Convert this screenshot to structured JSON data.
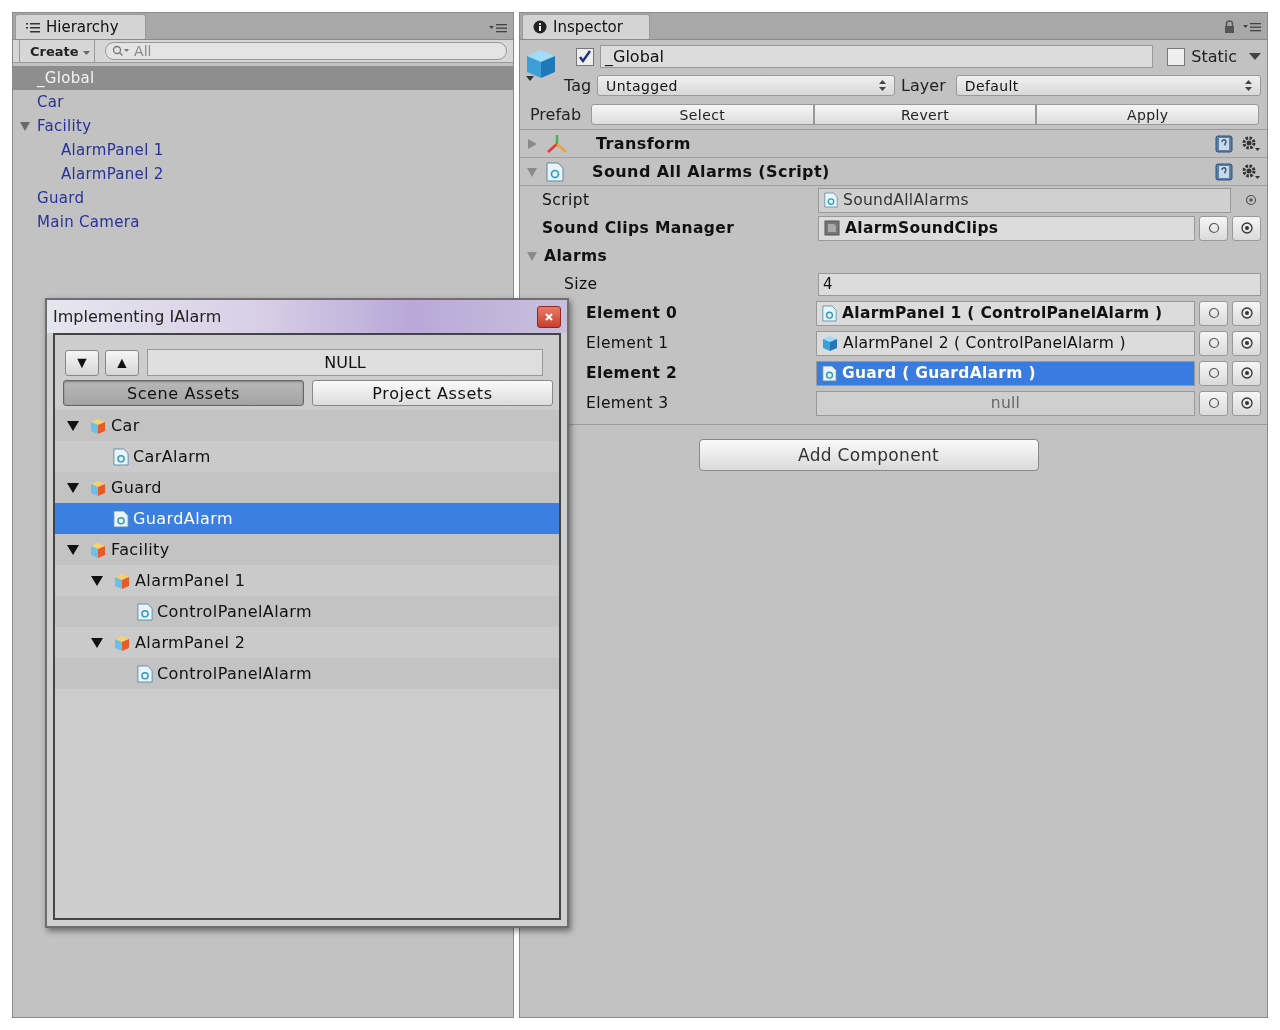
{
  "hierarchy": {
    "tab_label": "Hierarchy",
    "create_label": "Create",
    "search_placeholder": "All",
    "items": [
      {
        "label": "_Global",
        "selected": true
      },
      {
        "label": "Car",
        "selected": false
      },
      {
        "label": "Facility",
        "selected": false,
        "expanded": true,
        "children": [
          {
            "label": "AlarmPanel 1",
            "selected": false
          },
          {
            "label": "AlarmPanel 2",
            "selected": false
          }
        ]
      },
      {
        "label": "Guard",
        "selected": false
      },
      {
        "label": "Main Camera",
        "selected": false
      }
    ]
  },
  "inspector": {
    "tab_label": "Inspector",
    "object_active": true,
    "object_name": "_Global",
    "static": false,
    "static_label": "Static",
    "tag_label": "Tag",
    "tag_value": "Untagged",
    "layer_label": "Layer",
    "layer_value": "Default",
    "prefab_label": "Prefab",
    "prefab_buttons": [
      "Select",
      "Revert",
      "Apply"
    ],
    "components": [
      {
        "kind": "transform",
        "name": "Transform",
        "expanded": false
      },
      {
        "kind": "script",
        "name": "Sound All Alarms (Script)",
        "expanded": true,
        "fields": [
          {
            "kind": "script_ref",
            "label": "Script",
            "value": "SoundAllAlarms",
            "bold": false
          },
          {
            "kind": "object",
            "label": "Sound Clips Manager",
            "value": "AlarmSoundClips",
            "bold": true
          },
          {
            "kind": "array",
            "label": "Alarms",
            "expanded": true,
            "size_label": "Size",
            "size": "4",
            "elements": [
              {
                "kind": "script",
                "label": "Element 0",
                "value": "AlarmPanel 1 ( ControlPanelAlarm )",
                "bold": true,
                "selected": false
              },
              {
                "kind": "gameobject",
                "label": "Element 1",
                "value": "AlarmPanel 2 ( ControlPanelAlarm )",
                "bold": false,
                "selected": false
              },
              {
                "kind": "script",
                "label": "Element 2",
                "value": "Guard ( GuardAlarm )",
                "bold": true,
                "selected": true
              },
              {
                "kind": "none",
                "label": "Element 3",
                "value": "null",
                "bold": false,
                "selected": false
              }
            ]
          }
        ]
      }
    ],
    "add_component": "Add Component"
  },
  "dialog": {
    "title": "Implementing IAlarm",
    "null_label": "NULL",
    "down_label": "▼",
    "up_label": "▲",
    "tabs": [
      {
        "label": "Scene Assets",
        "selected": true
      },
      {
        "label": "Project Assets",
        "selected": false
      }
    ],
    "tree": [
      {
        "kind": "gameobject",
        "label": "Car",
        "expanded": true,
        "selected": false,
        "children": [
          {
            "kind": "script",
            "label": "CarAlarm",
            "selected": false
          }
        ]
      },
      {
        "kind": "gameobject",
        "label": "Guard",
        "expanded": true,
        "selected": false,
        "children": [
          {
            "kind": "script",
            "label": "GuardAlarm",
            "selected": true
          }
        ]
      },
      {
        "kind": "gameobject",
        "label": "Facility",
        "expanded": true,
        "selected": false,
        "children": [
          {
            "kind": "gameobject",
            "label": "AlarmPanel 1",
            "expanded": true,
            "selected": false,
            "children": [
              {
                "kind": "script",
                "label": "ControlPanelAlarm",
                "selected": false
              }
            ]
          },
          {
            "kind": "gameobject",
            "label": "AlarmPanel 2",
            "expanded": true,
            "selected": false,
            "children": [
              {
                "kind": "script",
                "label": "ControlPanelAlarm",
                "selected": false
              }
            ]
          }
        ]
      }
    ]
  }
}
